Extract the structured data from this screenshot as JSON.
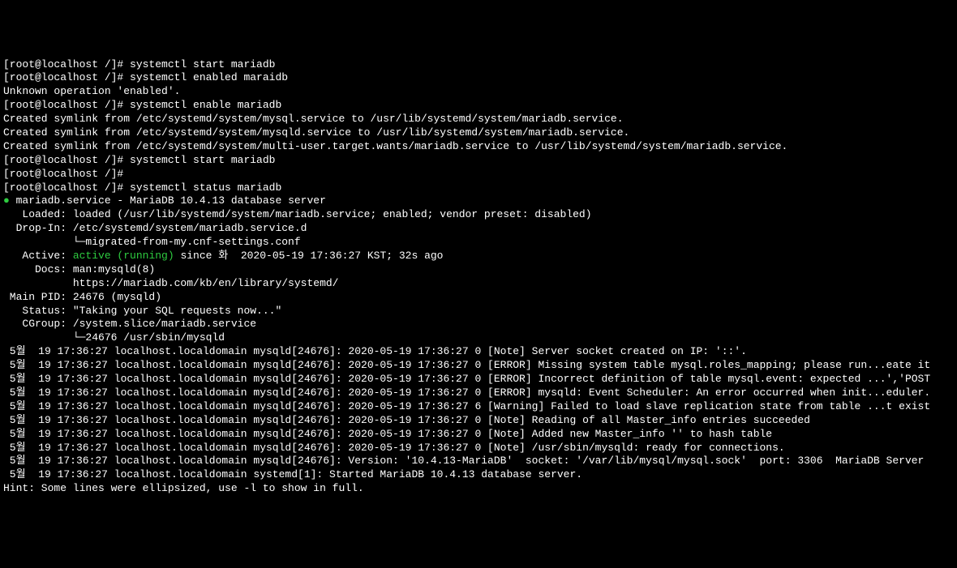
{
  "lines": [
    {
      "type": "prompt",
      "prompt": "[root@localhost /]# ",
      "cmd": "systemctl start mariadb"
    },
    {
      "type": "prompt",
      "prompt": "[root@localhost /]# ",
      "cmd": "systemctl enabled maraidb"
    },
    {
      "type": "text",
      "content": "Unknown operation 'enabled'."
    },
    {
      "type": "prompt",
      "prompt": "[root@localhost /]# ",
      "cmd": "systemctl enable mariadb"
    },
    {
      "type": "text",
      "content": "Created symlink from /etc/systemd/system/mysql.service to /usr/lib/systemd/system/mariadb.service."
    },
    {
      "type": "text",
      "content": "Created symlink from /etc/systemd/system/mysqld.service to /usr/lib/systemd/system/mariadb.service."
    },
    {
      "type": "text",
      "content": "Created symlink from /etc/systemd/system/multi-user.target.wants/mariadb.service to /usr/lib/systemd/system/mariadb.service."
    },
    {
      "type": "prompt",
      "prompt": "[root@localhost /]# ",
      "cmd": "systemctl start mariadb"
    },
    {
      "type": "prompt",
      "prompt": "[root@localhost /]# ",
      "cmd": ""
    },
    {
      "type": "prompt",
      "prompt": "[root@localhost /]# ",
      "cmd": "systemctl status mariadb"
    },
    {
      "type": "dot",
      "content": " mariadb.service - MariaDB 10.4.13 database server"
    },
    {
      "type": "text",
      "content": "   Loaded: loaded (/usr/lib/systemd/system/mariadb.service; enabled; vendor preset: disabled)"
    },
    {
      "type": "text",
      "content": "  Drop-In: /etc/systemd/system/mariadb.service.d"
    },
    {
      "type": "text",
      "content": "           └─migrated-from-my.cnf-settings.conf"
    },
    {
      "type": "active",
      "prefix": "   Active: ",
      "status": "active (running)",
      "suffix": " since 화  2020-05-19 17:36:27 KST; 32s ago"
    },
    {
      "type": "text",
      "content": "     Docs: man:mysqld(8)"
    },
    {
      "type": "text",
      "content": "           https://mariadb.com/kb/en/library/systemd/"
    },
    {
      "type": "text",
      "content": " Main PID: 24676 (mysqld)"
    },
    {
      "type": "text",
      "content": "   Status: \"Taking your SQL requests now...\""
    },
    {
      "type": "text",
      "content": "   CGroup: /system.slice/mariadb.service"
    },
    {
      "type": "text",
      "content": "           └─24676 /usr/sbin/mysqld"
    },
    {
      "type": "text",
      "content": ""
    },
    {
      "type": "text",
      "content": " 5월  19 17:36:27 localhost.localdomain mysqld[24676]: 2020-05-19 17:36:27 0 [Note] Server socket created on IP: '::'."
    },
    {
      "type": "text",
      "content": " 5월  19 17:36:27 localhost.localdomain mysqld[24676]: 2020-05-19 17:36:27 0 [ERROR] Missing system table mysql.roles_mapping; please run...eate it"
    },
    {
      "type": "text",
      "content": " 5월  19 17:36:27 localhost.localdomain mysqld[24676]: 2020-05-19 17:36:27 0 [ERROR] Incorrect definition of table mysql.event: expected ...','POST"
    },
    {
      "type": "text",
      "content": " 5월  19 17:36:27 localhost.localdomain mysqld[24676]: 2020-05-19 17:36:27 0 [ERROR] mysqld: Event Scheduler: An error occurred when init...eduler."
    },
    {
      "type": "text",
      "content": " 5월  19 17:36:27 localhost.localdomain mysqld[24676]: 2020-05-19 17:36:27 6 [Warning] Failed to load slave replication state from table ...t exist"
    },
    {
      "type": "text",
      "content": " 5월  19 17:36:27 localhost.localdomain mysqld[24676]: 2020-05-19 17:36:27 0 [Note] Reading of all Master_info entries succeeded"
    },
    {
      "type": "text",
      "content": " 5월  19 17:36:27 localhost.localdomain mysqld[24676]: 2020-05-19 17:36:27 0 [Note] Added new Master_info '' to hash table"
    },
    {
      "type": "text",
      "content": " 5월  19 17:36:27 localhost.localdomain mysqld[24676]: 2020-05-19 17:36:27 0 [Note] /usr/sbin/mysqld: ready for connections."
    },
    {
      "type": "text",
      "content": " 5월  19 17:36:27 localhost.localdomain mysqld[24676]: Version: '10.4.13-MariaDB'  socket: '/var/lib/mysql/mysql.sock'  port: 3306  MariaDB Server"
    },
    {
      "type": "text",
      "content": " 5월  19 17:36:27 localhost.localdomain systemd[1]: Started MariaDB 10.4.13 database server."
    },
    {
      "type": "text",
      "content": "Hint: Some lines were ellipsized, use -l to show in full."
    }
  ]
}
